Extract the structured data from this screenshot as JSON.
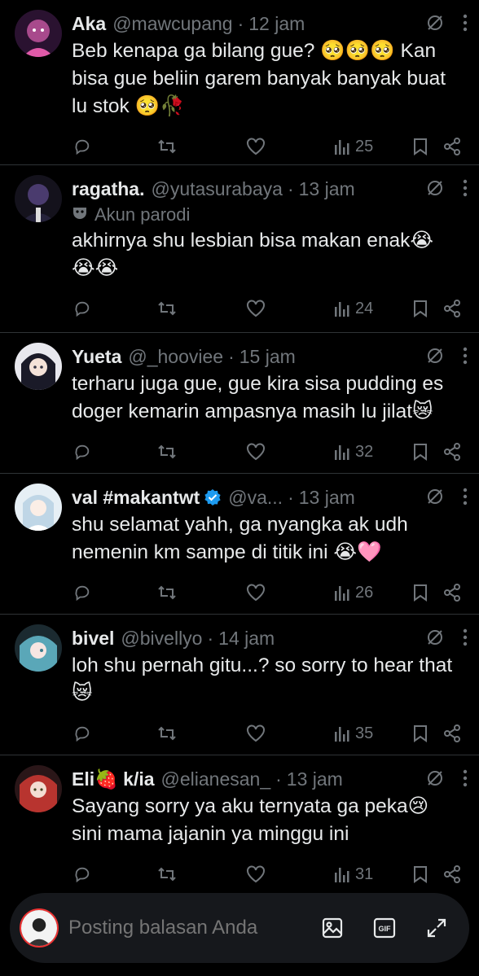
{
  "tweets": [
    {
      "name": "Aka",
      "handle": "@mawcupang",
      "time": "12 jam",
      "text": "Beb kenapa ga bilang gue? 🥺🥺🥺 Kan bisa gue beliin garem banyak banyak buat lu stok 🥺🥀",
      "views": "25",
      "avatar_color": "#a84a8c"
    },
    {
      "name": "ragatha.",
      "handle": "@yutasurabaya",
      "time": "13 jam",
      "parody_label": "Akun parodi",
      "text": "akhirnya shu lesbian bisa makan enak😭😭😭",
      "views": "24",
      "avatar_color": "#4a3b6e"
    },
    {
      "name": "Yueta",
      "handle": "@_hooviee",
      "time": "15 jam",
      "text": "terharu juga gue, gue kira sisa pudding es doger kemarin ampasnya masih lu jilat😿",
      "views": "32",
      "avatar_color": "#c9c9d6"
    },
    {
      "name": "val #makantwt",
      "handle": "@va...",
      "time": "13 jam",
      "text": "shu selamat yahh, ga nyangka ak udh nemenin km sampe di titik ini 😭🩷",
      "views": "26",
      "avatar_color": "#bfd6e6"
    },
    {
      "name": "bivel",
      "handle": "@bivellyo",
      "time": "14 jam",
      "text": "loh shu pernah gitu...? so sorry to hear that😿",
      "views": "35",
      "avatar_color": "#5aa7b8"
    },
    {
      "name": "Eli🍓 k/ia",
      "handle": "@elianesan_",
      "time": "13 jam",
      "text": "Sayang sorry ya aku ternyata ga peka😢 sini mama jajanin ya minggu ini",
      "views": "31",
      "avatar_color": "#b8342f"
    }
  ],
  "reply_bar": {
    "placeholder": "Posting balasan Anda"
  },
  "icons": {
    "reply": "reply-icon",
    "retweet": "retweet-icon",
    "like": "heart-icon",
    "views": "views-icon",
    "bookmark": "bookmark-icon",
    "share": "share-icon",
    "grok": "grok-icon",
    "more": "more-icon",
    "image": "image-icon",
    "gif": "gif-icon",
    "expand": "expand-icon"
  },
  "colors": {
    "background": "#000000",
    "text": "#e7e9ea",
    "muted": "#71767b",
    "verified": "#1d9bf0",
    "divider": "#2f3336"
  }
}
